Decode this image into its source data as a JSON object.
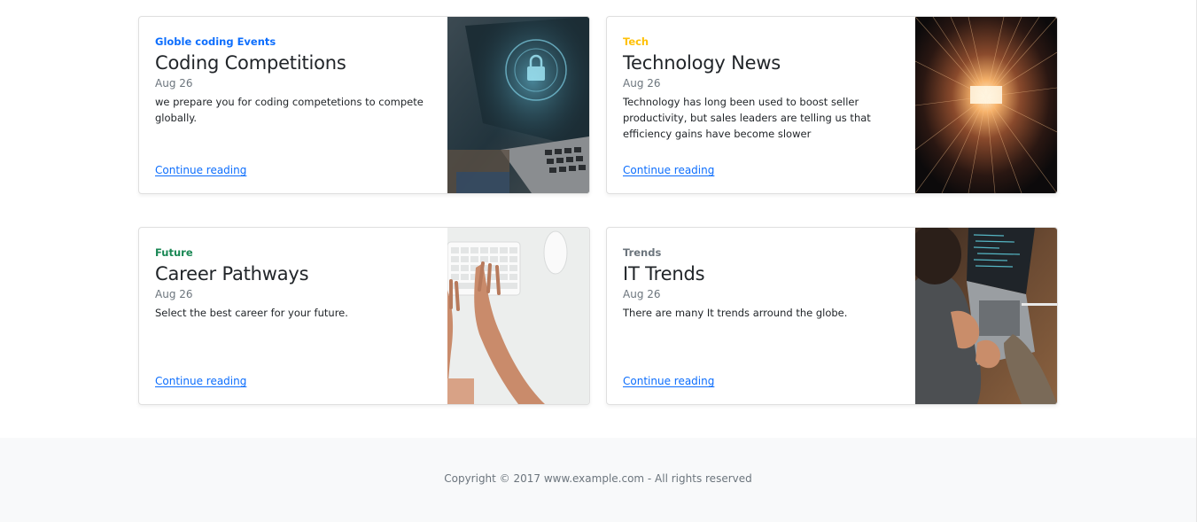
{
  "posts": [
    {
      "category": "Globle coding Events",
      "category_color": "#0d6efd",
      "title": "Coding Competitions",
      "date": "Aug 26",
      "text": "we prepare you for coding competetions to compete globally.",
      "link": "Continue reading",
      "image": "laptop-security-lock-image"
    },
    {
      "category": "Tech",
      "category_color": "#ffc107",
      "title": "Technology News",
      "date": "Aug 26",
      "text": "Technology has long been used to boost seller productivity, but sales leaders are telling us that efficiency gains have become slower",
      "link": "Continue reading",
      "image": "light-tunnel-image"
    },
    {
      "category": "Future",
      "category_color": "#198754",
      "title": "Career Pathways",
      "date": "Aug 26",
      "text": "Select the best career for your future.",
      "link": "Continue reading",
      "image": "hands-on-keyboard-image"
    },
    {
      "category": "Trends",
      "category_color": "#6c757d",
      "title": "IT Trends",
      "date": "Aug 26",
      "text": "There are many It trends arround the globe.",
      "link": "Continue reading",
      "image": "person-coding-laptop-image"
    }
  ],
  "footer": {
    "copyright": "Copyright © 2017 www.example.com - All rights reserved"
  }
}
